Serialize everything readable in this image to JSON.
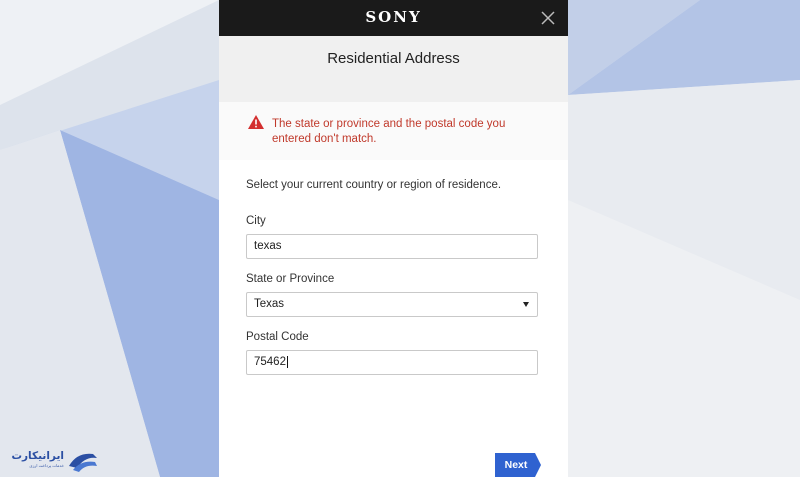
{
  "header": {
    "brand": "SONY",
    "close_icon": "close-icon"
  },
  "dialog": {
    "title": "Residential Address",
    "error_message": "The state or province and the postal code you entered don't match.",
    "intro_text": "Select your current country or region of residence."
  },
  "form": {
    "city": {
      "label": "City",
      "value": "texas"
    },
    "state": {
      "label": "State or Province",
      "value": "Texas"
    },
    "postal": {
      "label": "Postal Code",
      "value": "75462"
    }
  },
  "actions": {
    "next_label": "Next"
  },
  "watermark": {
    "name": "ایرانیکارت",
    "tagline": "خدمات پرداخت ارزی"
  },
  "colors": {
    "header_bg": "#1a1a1a",
    "error": "#c0392b",
    "primary_button": "#2f62d0"
  }
}
